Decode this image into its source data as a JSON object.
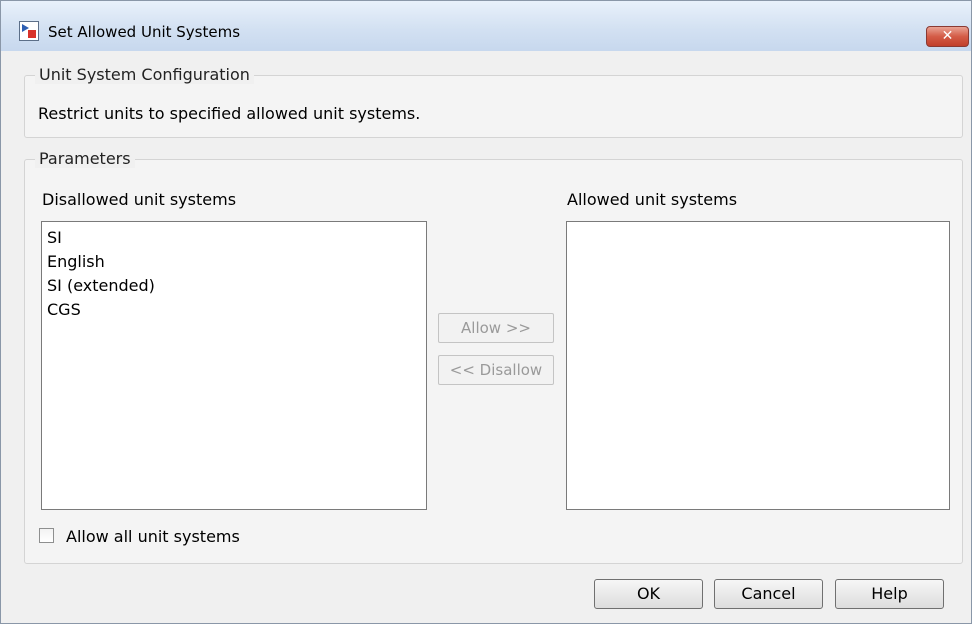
{
  "window": {
    "title": "Set Allowed Unit Systems",
    "close_label": "✕"
  },
  "config_group": {
    "legend": "Unit System Configuration",
    "description": "Restrict units to specified allowed unit systems."
  },
  "params_group": {
    "legend": "Parameters"
  },
  "disallowed": {
    "label": "Disallowed unit systems",
    "items": [
      "SI",
      "English",
      "SI (extended)",
      "CGS"
    ]
  },
  "allowed": {
    "label": "Allowed unit systems",
    "items": []
  },
  "buttons": {
    "allow": "Allow >>",
    "disallow": "<< Disallow"
  },
  "allow_all": {
    "label": "Allow all unit systems",
    "checked": false
  },
  "footer": {
    "ok": "OK",
    "cancel": "Cancel",
    "help": "Help"
  }
}
